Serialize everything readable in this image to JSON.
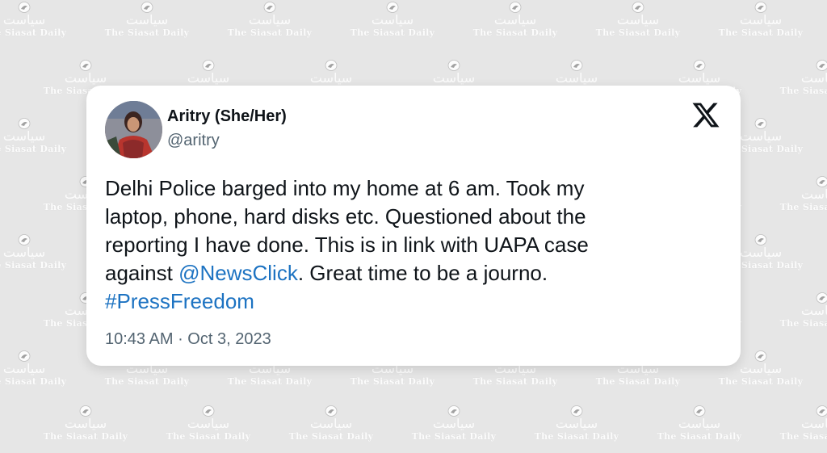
{
  "watermark": {
    "urdu": "سیاست",
    "english": "The Siasat Daily",
    "icon": "bird-logo-icon"
  },
  "tweet": {
    "author_name": "Aritry (She/Her)",
    "author_handle": "@aritry",
    "platform_icon": "x-logo-icon",
    "text_parts": {
      "line1": "Delhi Police barged into my home at 6 am. Took my",
      "line2": "laptop, phone, hard disks etc. Questioned about the",
      "line3": "reporting I have done. This is  in link with UAPA case",
      "line4_prefix": "against ",
      "mention": "@NewsClick",
      "line4_suffix": ". Great time to be a journo.",
      "hashtag": "#PressFreedom"
    },
    "time": "10:43 AM",
    "separator": " · ",
    "date": "Oct 3, 2023"
  },
  "colors": {
    "background": "#e6e6e6",
    "card": "#ffffff",
    "link": "#1d73c2",
    "text": "#0f1419",
    "muted": "#536471"
  }
}
